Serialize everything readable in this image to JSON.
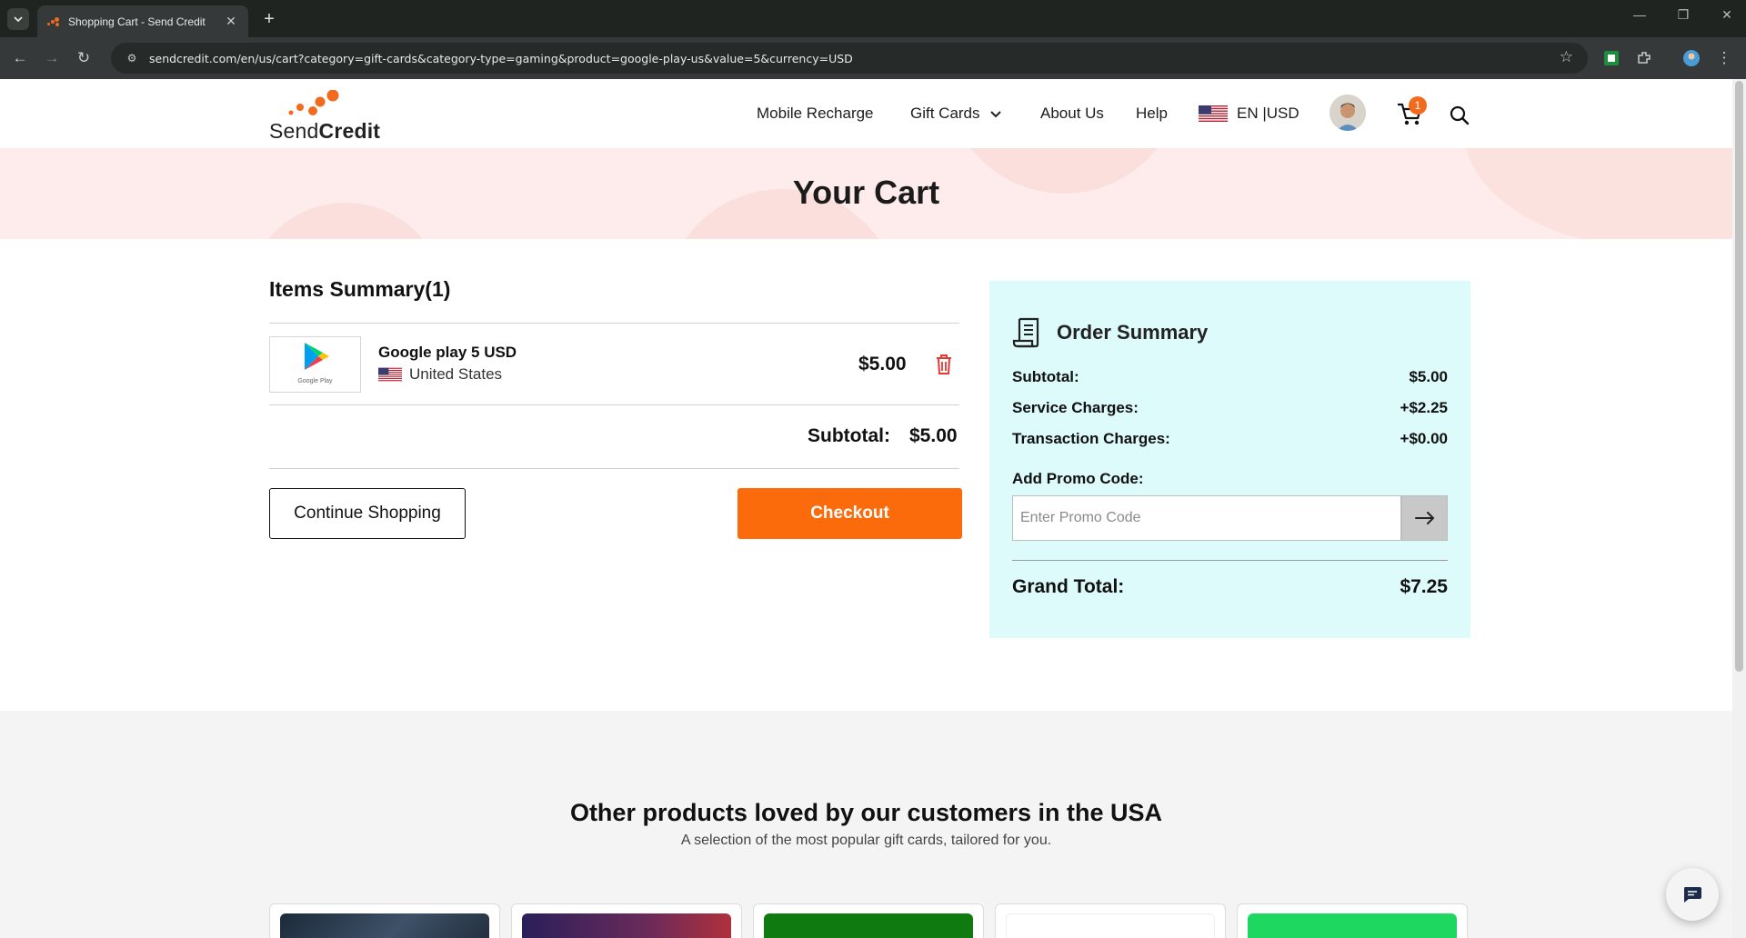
{
  "browser": {
    "tab_title": "Shopping Cart - Send Credit",
    "url": "sendcredit.com/en/us/cart?category=gift-cards&category-type=gaming&product=google-play-us&value=5&currency=USD"
  },
  "header": {
    "logo": {
      "part1": "Send",
      "part2": "Credit"
    },
    "nav": [
      "Mobile Recharge",
      "Gift Cards",
      "About Us",
      "Help"
    ],
    "locale": "EN |USD",
    "cart_count": "1"
  },
  "hero": {
    "title": "Your Cart"
  },
  "items": {
    "title": "Items Summary(1)",
    "products": [
      {
        "name": "Google play 5 USD",
        "country": "United States",
        "price": "$5.00",
        "image_caption": "Google Play"
      }
    ],
    "subtotal_label": "Subtotal:",
    "subtotal_value": "$5.00",
    "continue_label": "Continue Shopping",
    "checkout_label": "Checkout"
  },
  "order_summary": {
    "title": "Order Summary",
    "rows": [
      {
        "label": "Subtotal:",
        "value": "$5.00"
      },
      {
        "label": "Service Charges:",
        "value": "+$2.25"
      },
      {
        "label": "Transaction Charges:",
        "value": "+$0.00"
      }
    ],
    "promo_label": "Add Promo Code:",
    "promo_placeholder": "Enter Promo Code",
    "grand_total_label": "Grand Total:",
    "grand_total_value": "$7.25"
  },
  "other_products": {
    "title": "Other products loved by our customers in the USA",
    "subtitle": "A selection of the most popular gift cards, tailored for you."
  },
  "colors": {
    "accent": "#fb6a0b",
    "summary_bg": "#ddfbfb",
    "hero_bg": "#fdeceb"
  }
}
